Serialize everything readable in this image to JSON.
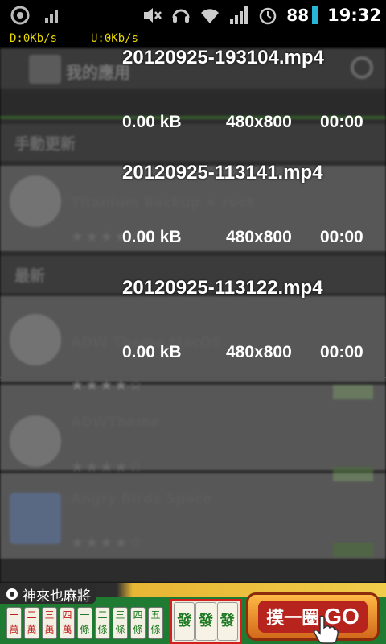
{
  "status_bar": {
    "battery": "88",
    "time": "19:32",
    "download_speed": "D:0Kb/s",
    "upload_speed": "U:0Kb/s"
  },
  "icons": {
    "app_notification": "circle-a-icon",
    "signal": "signal-icon",
    "mute": "mute-icon",
    "headset": "headset-icon",
    "wifi": "wifi-icon",
    "cell_signal": "signal-bars-icon",
    "alarm": "alarm-icon"
  },
  "videos": [
    {
      "name": "20120925-193104.mp4",
      "size": "0.00 kB",
      "resolution": "480x800",
      "duration": "00:00"
    },
    {
      "name": "20120925-113141.mp4",
      "size": "0.00 kB",
      "resolution": "480x800",
      "duration": "00:00"
    },
    {
      "name": "20120925-113122.mp4",
      "size": "0.00 kB",
      "resolution": "480x800",
      "duration": "00:00"
    }
  ],
  "background_app": {
    "apps": [
      {
        "title": "Titanium Backup ★ root"
      },
      {
        "title": "ADW Theme MacOS"
      },
      {
        "title": "ADWTheme"
      },
      {
        "title": "Angry Birds Space"
      }
    ]
  },
  "ad": {
    "brand": "神來也麻將",
    "tiles": [
      "一萬",
      "二萬",
      "三萬",
      "四萬",
      "一條",
      "二條",
      "三條",
      "四條",
      "五條"
    ],
    "highlight_tiles": [
      "發",
      "發",
      "發"
    ],
    "cta_cn": "摸一圈",
    "cta_en": "GO"
  },
  "colors": {
    "speed_text": "#e8d800",
    "battery_bar": "#29b6d6",
    "ad_green": "#1f7a32",
    "highlight_border": "#d41f1f"
  }
}
